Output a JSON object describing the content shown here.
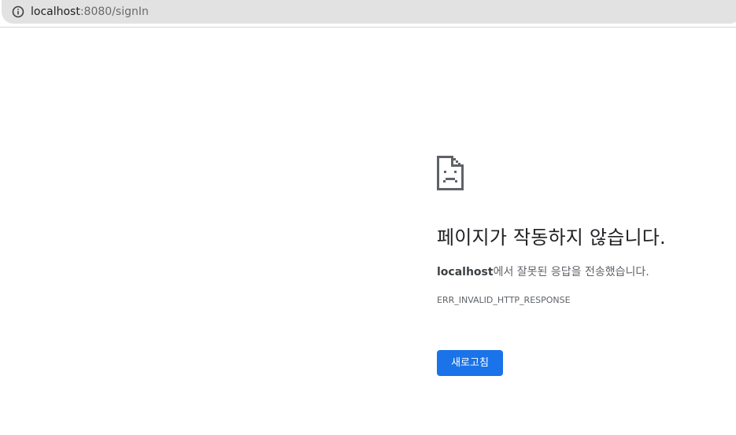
{
  "address_bar": {
    "url_host": "localhost",
    "url_rest": ":8080/signIn",
    "info_icon": "info-circle-icon"
  },
  "error_page": {
    "icon": "sad-page-icon",
    "heading": "페이지가 작동하지 않습니다.",
    "description_host": "localhost",
    "description_rest": "에서 잘못된 응답을 전송했습니다.",
    "error_code": "ERR_INVALID_HTTP_RESPONSE",
    "reload_label": "새로고침"
  },
  "colors": {
    "omnibox_bg": "#e2e2e2",
    "button_bg": "#1a73e8",
    "text_primary": "#202124",
    "text_secondary": "#5f6368"
  }
}
